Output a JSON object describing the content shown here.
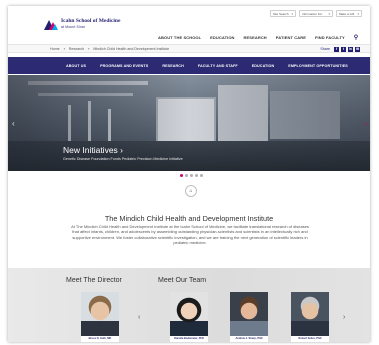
{
  "utility": {
    "selects": [
      {
        "label": "Site Search"
      },
      {
        "label": "Information For"
      },
      {
        "label": "Make a Gift"
      }
    ]
  },
  "logo": {
    "line1": "Icahn School of Medicine",
    "line2": "at Mount Sinai"
  },
  "main_nav": [
    "ABOUT THE SCHOOL",
    "EDUCATION",
    "RESEARCH",
    "PATIENT CARE",
    "FIND FACULTY"
  ],
  "breadcrumb": [
    "Home",
    "Research",
    "Mindich Child Health and Development Institute"
  ],
  "share": {
    "label": "Share",
    "icons": [
      "f",
      "t",
      "in",
      "✉"
    ]
  },
  "sub_nav": [
    "ABOUT US",
    "PROGRAMS AND EVENTS",
    "RESEARCH",
    "FACULTY AND STAFF",
    "EDUCATION",
    "EMPLOYMENT OPPORTUNITIES"
  ],
  "hero": {
    "title": "New Initiatives ›",
    "subtitle": "Genetic Disease Foundation Funds Pediatric Precision Medicine Initiative",
    "slides": 5,
    "active_slide": 1
  },
  "institute": {
    "title": "The Mindich Child Health and Development Institute",
    "description": "At The Mindich Child Health and Development Institute at the Icahn School of Medicine, we facilitate translational research of diseases that affect infants, children, and adolescents by assembling outstanding physician-scientists and scientists in an intellectually rich and supportive environment. We foster collaborative scientific investigation, and we are training the next generation of scientific leaders in pediatric medicine."
  },
  "team": {
    "director_heading": "Meet The Director",
    "team_heading": "Meet Our Team",
    "members": [
      {
        "name": "Bruce D. Gelb, MD"
      },
      {
        "name": "Daniela Bodemeier, PhD"
      },
      {
        "name": "Andrew J. Sharp, PhD"
      },
      {
        "name": "Robert Sebra, PhD"
      }
    ]
  },
  "colors": {
    "brand_navy": "#2b2a72",
    "accent_magenta": "#d6006f",
    "accent_cyan": "#00aeef"
  }
}
